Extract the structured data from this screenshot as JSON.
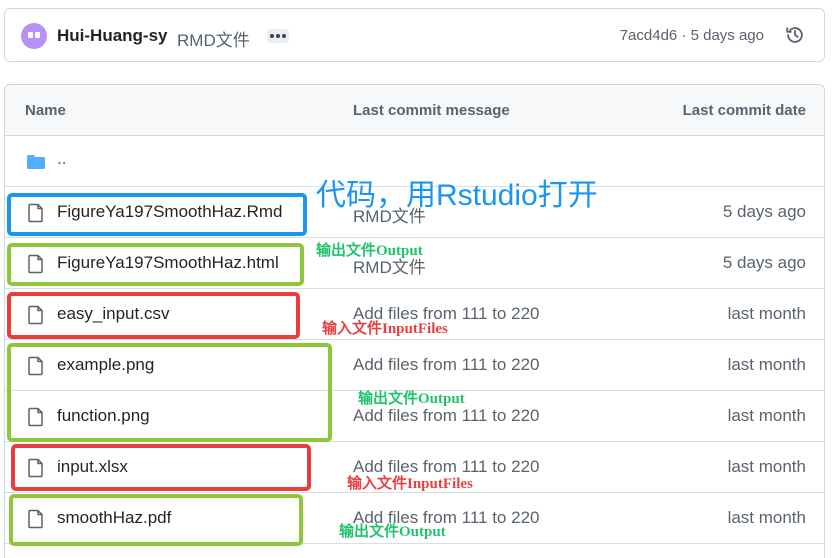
{
  "header": {
    "author": "Hui-Huang-sy",
    "commit_message": "RMD文件",
    "commit_meta": "7acd4d6 · 5 days ago",
    "avatar_color": "#b692f6"
  },
  "table": {
    "columns": {
      "name": "Name",
      "message": "Last commit message",
      "date": "Last commit date"
    },
    "parent_label": "..",
    "rows": [
      {
        "name": "FigureYa197SmoothHaz.Rmd",
        "message": "RMD文件",
        "date": "5 days ago"
      },
      {
        "name": "FigureYa197SmoothHaz.html",
        "message": "RMD文件",
        "date": "5 days ago"
      },
      {
        "name": "easy_input.csv",
        "message": "Add files from 111 to 220",
        "date": "last month"
      },
      {
        "name": "example.png",
        "message": "Add files from 111 to 220",
        "date": "last month"
      },
      {
        "name": "function.png",
        "message": "Add files from 111 to 220",
        "date": "last month"
      },
      {
        "name": "input.xlsx",
        "message": "Add files from 111 to 220",
        "date": "last month"
      },
      {
        "name": "smoothHaz.pdf",
        "message": "Add files from 111 to 220",
        "date": "last month"
      }
    ]
  },
  "annotations": {
    "code_note": "代码，用Rstudio打开",
    "output_note_1": "输出文件Output",
    "input_note_1": "输入文件InputFiles",
    "output_note_2": "输出文件Output",
    "input_note_2": "输入文件InputFiles",
    "output_note_3": "输出文件Output"
  },
  "colors": {
    "folder": "#54aeff",
    "annotation_blue": "#1a96f0",
    "annotation_green": "#8fc63c",
    "annotation_red": "#ea3c3c"
  }
}
